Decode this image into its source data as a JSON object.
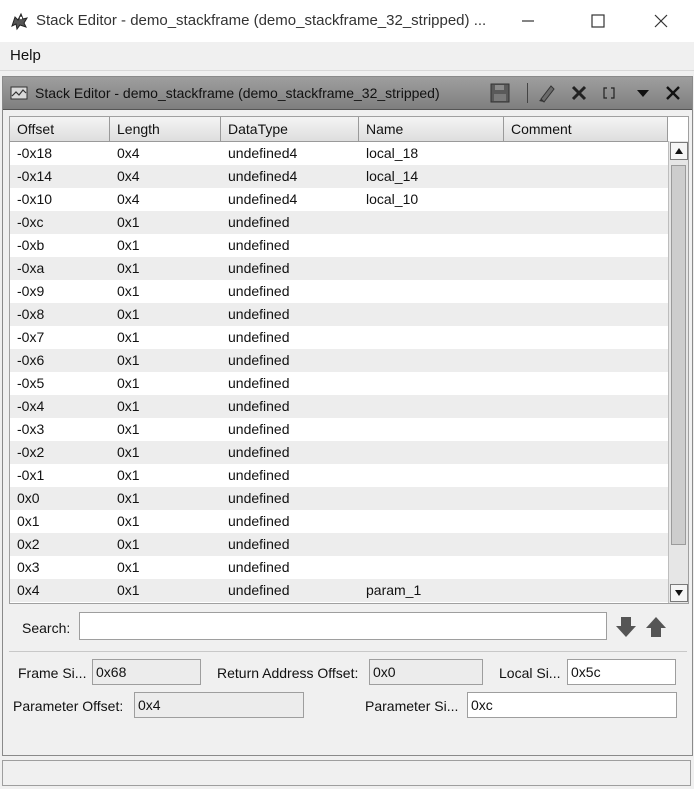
{
  "window": {
    "title": "Stack Editor - demo_stackframe (demo_stackframe_32_stripped) ...",
    "icon": "dragon-app-icon",
    "controls": [
      "minimize-icon",
      "maximize-icon",
      "close-icon"
    ]
  },
  "menu": {
    "help": "Help"
  },
  "panel": {
    "title": "Stack Editor - demo_stackframe (demo_stackframe_32_stripped)",
    "toolbar": [
      "save-icon",
      "edit-icon",
      "delete-icon",
      "bracket-icon",
      "menu-dropdown-icon",
      "close-icon"
    ]
  },
  "table": {
    "columns": [
      "Offset",
      "Length",
      "DataType",
      "Name",
      "Comment"
    ],
    "rows": [
      [
        "-0x18",
        "0x4",
        "undefined4",
        "local_18",
        ""
      ],
      [
        "-0x14",
        "0x4",
        "undefined4",
        "local_14",
        ""
      ],
      [
        "-0x10",
        "0x4",
        "undefined4",
        "local_10",
        ""
      ],
      [
        "-0xc",
        "0x1",
        "undefined",
        "",
        ""
      ],
      [
        "-0xb",
        "0x1",
        "undefined",
        "",
        ""
      ],
      [
        "-0xa",
        "0x1",
        "undefined",
        "",
        ""
      ],
      [
        "-0x9",
        "0x1",
        "undefined",
        "",
        ""
      ],
      [
        "-0x8",
        "0x1",
        "undefined",
        "",
        ""
      ],
      [
        "-0x7",
        "0x1",
        "undefined",
        "",
        ""
      ],
      [
        "-0x6",
        "0x1",
        "undefined",
        "",
        ""
      ],
      [
        "-0x5",
        "0x1",
        "undefined",
        "",
        ""
      ],
      [
        "-0x4",
        "0x1",
        "undefined",
        "",
        ""
      ],
      [
        "-0x3",
        "0x1",
        "undefined",
        "",
        ""
      ],
      [
        "-0x2",
        "0x1",
        "undefined",
        "",
        ""
      ],
      [
        "-0x1",
        "0x1",
        "undefined",
        "",
        ""
      ],
      [
        "0x0",
        "0x1",
        "undefined",
        "",
        ""
      ],
      [
        "0x1",
        "0x1",
        "undefined",
        "",
        ""
      ],
      [
        "0x2",
        "0x1",
        "undefined",
        "",
        ""
      ],
      [
        "0x3",
        "0x1",
        "undefined",
        "",
        ""
      ],
      [
        "0x4",
        "0x1",
        "undefined",
        "param_1",
        ""
      ]
    ]
  },
  "search": {
    "label": "Search:",
    "value": ""
  },
  "frame": {
    "frame_size_label": "Frame Si...",
    "frame_size_value": "0x68",
    "return_offset_label": "Return Address Offset:",
    "return_offset_value": "0x0",
    "local_size_label": "Local Si...",
    "local_size_value": "0x5c",
    "param_offset_label": "Parameter Offset:",
    "param_offset_value": "0x4",
    "param_size_label": "Parameter Si...",
    "param_size_value": "0xc"
  }
}
